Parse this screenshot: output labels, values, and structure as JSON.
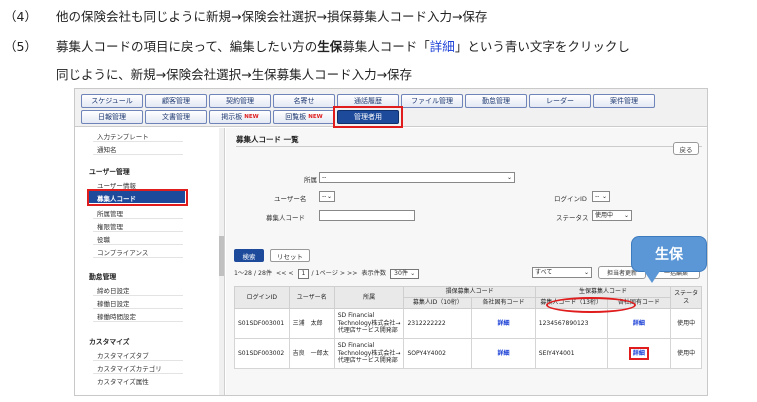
{
  "instructions": {
    "step4_num": "（4）",
    "step4_text": "他の保険会社も同じように新規→保険会社選択→損保募集人コード入力→保存",
    "step5_num": "（5）",
    "step5_a": "募集人コードの項目に戻って、編集したい方の",
    "step5_bold": "生保",
    "step5_b": "募集人コード「",
    "step5_link": "詳細",
    "step5_c": "」という青い文字をクリックし",
    "step5_cont": "同じように、新規→保険会社選択→生保募集人コード入力→保存"
  },
  "nav": {
    "row1": [
      "スケジュール",
      "顧客管理",
      "契約管理",
      "名寄せ",
      "通話履歴",
      "ファイル管理",
      "勤怠管理",
      "レーダー",
      "案件管理"
    ],
    "row2": {
      "daily": "日報管理",
      "docs": "文書管理",
      "bulletin": "掲示板",
      "circular": "回覧板",
      "admin": "管理者用",
      "new_badge": "NEW"
    }
  },
  "sidebar": {
    "top_items": [
      "入力テンプレート",
      "通知名"
    ],
    "user_mgmt_head": "ユーザー管理",
    "user_mgmt_items": [
      "ユーザー情報",
      "募集人コード",
      "所属管理",
      "権限管理",
      "役職",
      "コンプライアンス"
    ],
    "attendance_head": "勤怠管理",
    "attendance_items": [
      "締め日設定",
      "稼働日設定",
      "稼働時間設定"
    ],
    "customize_head": "カスタマイズ",
    "customize_items": [
      "カスタマイズタブ",
      "カスタマイズカテゴリ",
      "カスタマイズ属性"
    ]
  },
  "main": {
    "title": "募集人コード 一覧",
    "back": "戻る",
    "filters": {
      "affiliation_label": "所属",
      "affiliation_value": "--",
      "username_label": "ユーザー名",
      "username_value": "--",
      "code_label": "募集人コード",
      "login_label": "ログインID",
      "login_value": "--",
      "status_label": "ステータス",
      "status_value": "使用中"
    },
    "search": "検索",
    "reset": "リセット",
    "pager": {
      "range": "1～28 / 28件",
      "prev": "<<  <",
      "page": "1",
      "of": "/ 1ページ",
      "next": ">  >>",
      "per_label": "表示件数",
      "per_value": "30件"
    },
    "toolbar": {
      "all": "すべて",
      "update": "担当者更新",
      "bulk_edit": "一括編集"
    },
    "table": {
      "h_login": "ログインID",
      "h_user": "ユーザー名",
      "h_affil": "所属",
      "h_sonpo": "損保募集人コード",
      "h_seiho": "生保募集人コード",
      "h_status": "ステータス",
      "h_sonpo_id": "募集人ID（10桁）",
      "h_sonpo_own": "各社固有コード",
      "h_seiho_code": "募集人コード（13桁）",
      "h_seiho_own": "各社固有コード",
      "rows": [
        {
          "login": "S01SDF003001",
          "user": "三浦　太郎",
          "affil": "SD Financial Technology株式会社→代理店サービス開発部",
          "sonpo_id": "2312222222",
          "sonpo_detail": "詳細",
          "seiho_code": "1234567890123",
          "seiho_detail": "詳細",
          "status": "使用中"
        },
        {
          "login": "S01SDF003002",
          "user": "吉良　一郎太",
          "affil": "SD Financial Technology株式会社→代理店サービス開発部",
          "sonpo_id": "SOPY4Y4002",
          "sonpo_detail": "詳細",
          "seiho_code": "SEIY4Y4001",
          "seiho_detail": "詳細",
          "status": "使用中"
        }
      ]
    }
  },
  "callout": "生保"
}
